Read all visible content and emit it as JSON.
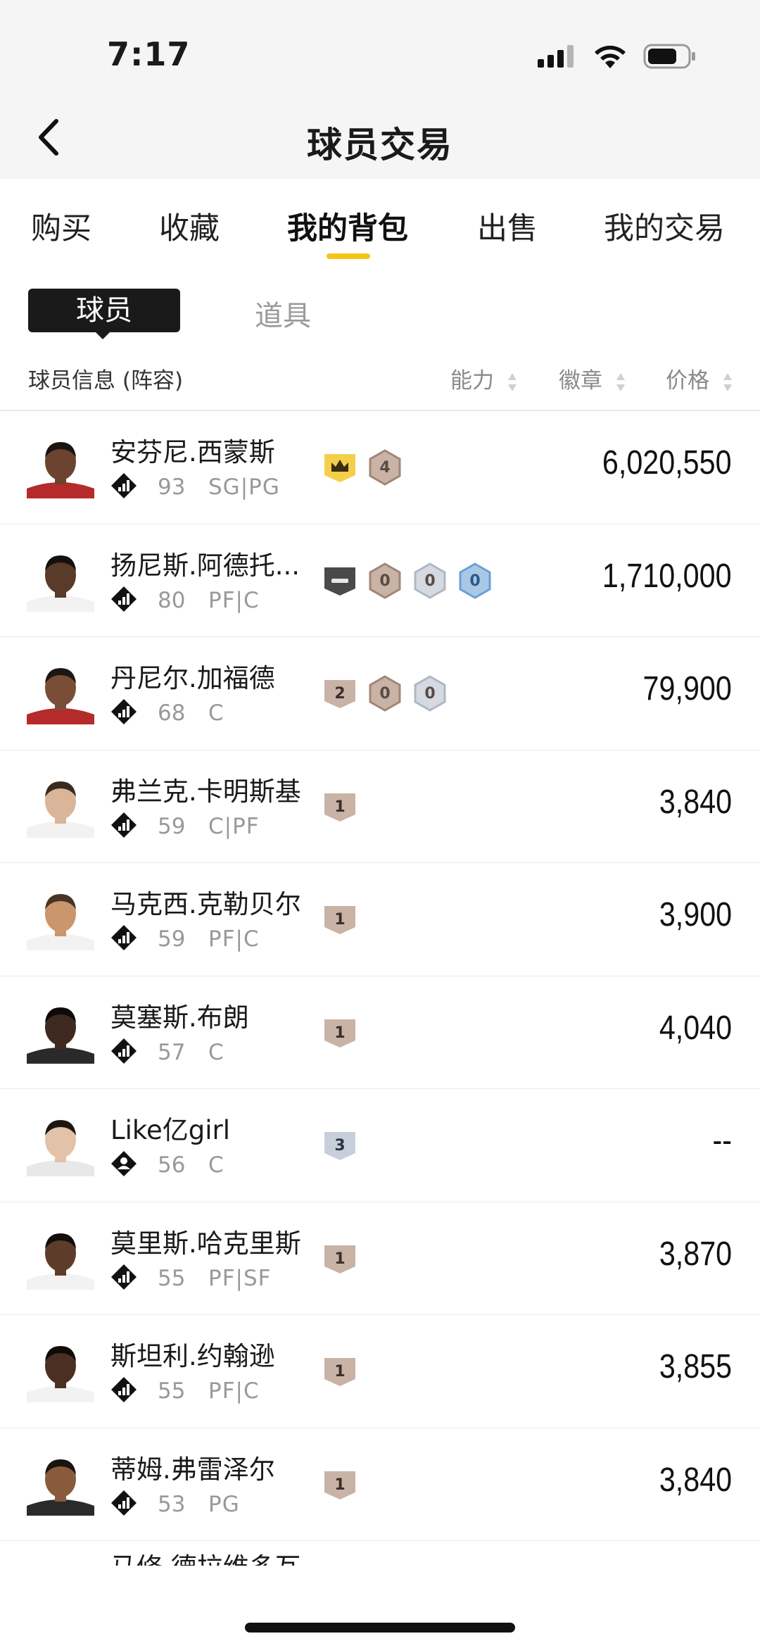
{
  "status": {
    "time": "7:17"
  },
  "nav": {
    "title": "球员交易"
  },
  "tabs": [
    {
      "label": "购买",
      "active": false
    },
    {
      "label": "收藏",
      "active": false
    },
    {
      "label": "我的背包",
      "active": true
    },
    {
      "label": "出售",
      "active": false
    },
    {
      "label": "我的交易",
      "active": false
    }
  ],
  "segments": {
    "player": "球员",
    "items": "道具"
  },
  "columns": {
    "info": "球员信息 (阵容)",
    "ability": "能力",
    "badge": "徽章",
    "price": "价格"
  },
  "colors": {
    "accent": "#f5c518",
    "dark": "#1a1a1a",
    "gray_text": "#999999"
  },
  "players": [
    {
      "name": "安芬尼.西蒙斯",
      "rating": "93",
      "pos": "SG|PG",
      "type_icon": "stats-icon",
      "price": "6,020,550",
      "badges": [
        {
          "shape": "gold-crown"
        },
        {
          "shape": "hex-bronze",
          "text": "4"
        }
      ]
    },
    {
      "name": "扬尼斯.阿德托...",
      "rating": "80",
      "pos": "PF|C",
      "type_icon": "stats-icon",
      "price": "1,710,000",
      "badges": [
        {
          "shape": "dark-dash"
        },
        {
          "shape": "hex-bronze",
          "text": "0"
        },
        {
          "shape": "hex-silver",
          "text": "0"
        },
        {
          "shape": "hex-blue",
          "text": "0"
        }
      ]
    },
    {
      "name": "丹尼尔.加福德",
      "rating": "68",
      "pos": "C",
      "type_icon": "stats-icon",
      "price": "79,900",
      "badges": [
        {
          "shape": "shield-bronze",
          "text": "2"
        },
        {
          "shape": "hex-bronze",
          "text": "0"
        },
        {
          "shape": "hex-silver",
          "text": "0"
        }
      ]
    },
    {
      "name": "弗兰克.卡明斯基",
      "rating": "59",
      "pos": "C|PF",
      "type_icon": "stats-icon",
      "price": "3,840",
      "badges": [
        {
          "shape": "shield-bronze",
          "text": "1"
        }
      ]
    },
    {
      "name": "马克西.克勒贝尔",
      "rating": "59",
      "pos": "PF|C",
      "type_icon": "stats-icon",
      "price": "3,900",
      "badges": [
        {
          "shape": "shield-bronze",
          "text": "1"
        }
      ]
    },
    {
      "name": "莫塞斯.布朗",
      "rating": "57",
      "pos": "C",
      "type_icon": "stats-icon",
      "price": "4,040",
      "badges": [
        {
          "shape": "shield-bronze",
          "text": "1"
        }
      ]
    },
    {
      "name": "Like亿girl",
      "rating": "56",
      "pos": "C",
      "type_icon": "person-icon",
      "price": "--",
      "badges": [
        {
          "shape": "shield-silver",
          "text": "3"
        }
      ]
    },
    {
      "name": "莫里斯.哈克里斯",
      "rating": "55",
      "pos": "PF|SF",
      "type_icon": "stats-icon",
      "price": "3,870",
      "badges": [
        {
          "shape": "shield-bronze",
          "text": "1"
        }
      ]
    },
    {
      "name": "斯坦利.约翰逊",
      "rating": "55",
      "pos": "PF|C",
      "type_icon": "stats-icon",
      "price": "3,855",
      "badges": [
        {
          "shape": "shield-bronze",
          "text": "1"
        }
      ]
    },
    {
      "name": "蒂姆.弗雷泽尔",
      "rating": "53",
      "pos": "PG",
      "type_icon": "stats-icon",
      "price": "3,840",
      "badges": [
        {
          "shape": "shield-bronze",
          "text": "1"
        }
      ]
    }
  ],
  "peek_player": {
    "name": "马修.德拉维多瓦"
  }
}
